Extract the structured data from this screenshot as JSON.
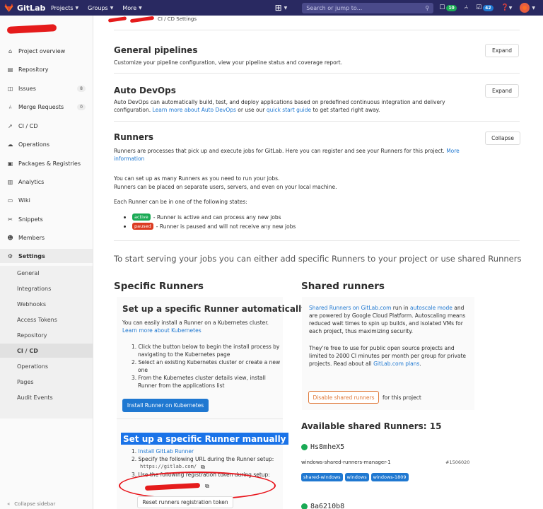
{
  "topbar": {
    "logo_text": "GitLab",
    "nav": [
      "Projects",
      "Groups",
      "More"
    ],
    "search_placeholder": "Search or jump to...",
    "todo_count": "10",
    "mr_count": "42"
  },
  "sidebar": {
    "items": [
      {
        "label": "Project overview",
        "icon": "home-icon"
      },
      {
        "label": "Repository",
        "icon": "book-icon"
      },
      {
        "label": "Issues",
        "icon": "issues-icon",
        "count": "8"
      },
      {
        "label": "Merge Requests",
        "icon": "merge-request-icon",
        "count": "0"
      },
      {
        "label": "CI / CD",
        "icon": "rocket-icon"
      },
      {
        "label": "Operations",
        "icon": "cloud-icon"
      },
      {
        "label": "Packages & Registries",
        "icon": "package-icon"
      },
      {
        "label": "Analytics",
        "icon": "chart-icon"
      },
      {
        "label": "Wiki",
        "icon": "book-open-icon"
      },
      {
        "label": "Snippets",
        "icon": "scissors-icon"
      },
      {
        "label": "Members",
        "icon": "users-icon"
      },
      {
        "label": "Settings",
        "icon": "gear-icon"
      }
    ],
    "sub_items": [
      "General",
      "Integrations",
      "Webhooks",
      "Access Tokens",
      "Repository",
      "CI / CD",
      "Operations",
      "Pages",
      "Audit Events"
    ],
    "collapse_label": "Collapse sidebar"
  },
  "breadcrumb": {
    "current": "CI / CD Settings"
  },
  "sections": {
    "pipelines": {
      "title": "General pipelines",
      "desc": "Customize your pipeline configuration, view your pipeline status and coverage report.",
      "button": "Expand"
    },
    "autodevops": {
      "title": "Auto DevOps",
      "desc_1": "Auto DevOps can automatically build, test, and deploy applications based on predefined continuous integration and delivery",
      "desc_2": "configuration. ",
      "link_1": "Learn more about Auto DevOps",
      "desc_3": " or use our ",
      "link_2": "quick start guide",
      "desc_4": " to get started right away.",
      "button": "Expand"
    },
    "runners": {
      "title": "Runners",
      "desc": "Runners are processes that pick up and execute jobs for GitLab. Here you can register and see your Runners for this project. ",
      "link_1": "More",
      "link_2": "information",
      "button": "Collapse"
    }
  },
  "runners_info": {
    "line_1": "You can set up as many Runners as you need to run your jobs.",
    "line_2": "Runners can be placed on separate users, servers, and even on your local machine.",
    "line_3": "Each Runner can be in one of the following states:",
    "active_label": "active",
    "active_text": "- Runner is active and can process any new jobs",
    "paused_label": "paused",
    "paused_text": "- Runner is paused and will not receive any new jobs",
    "lead": "To start serving your jobs you can either add specific Runners to your project or use shared Runners"
  },
  "specific": {
    "title": "Specific Runners",
    "auto_title": "Set up a specific Runner automatically",
    "auto_desc": "You can easily install a Runner on a Kubernetes cluster.",
    "auto_link": "Learn more about Kubernetes",
    "steps": [
      "1. Click the button below to begin the install process by",
      "navigating to the Kubernetes page",
      "2. Select an existing Kubernetes cluster or create a new",
      "one",
      "3. From the Kubernetes cluster details view, install",
      "Runner from the applications list"
    ],
    "install_button": "Install Runner on Kubernetes",
    "manual_title": "Set up a specific Runner manually",
    "manual_step_1_prefix": "1. ",
    "manual_step_1_link": "Install GitLab Runner",
    "manual_step_2": "2. Specify the following URL during the Runner setup:",
    "url": "https://gitlab.com/",
    "manual_step_3": "3. Use the following registration token during setup:",
    "reset_button": "Reset runners registration token"
  },
  "shared": {
    "title": "Shared runners",
    "p1_link_1": "Shared Runners on GitLab.com",
    "p1_a": " run in ",
    "p1_link_2": "autoscale mode",
    "p1_b": " and",
    "p1_lines": [
      "are powered by Google Cloud Platform. Autoscaling means",
      "reduced wait times to spin up builds, and isolated VMs for",
      "each project, thus maximizing security."
    ],
    "p2_lines": [
      "They're free to use for public open source projects and",
      "limited to 2000 CI minutes per month per group for private"
    ],
    "p2_last": "projects. Read about all ",
    "p2_link": "GitLab.com plans",
    "p2_end": ".",
    "disable_button": "Disable shared runners",
    "disable_suffix": "for this project",
    "available_title": "Available shared Runners: 15",
    "runner_1": {
      "name": "Hs8mheX5",
      "desc": "windows-shared-runners-manager-1",
      "id": "#1506020",
      "tags": [
        "shared-windows",
        "windows",
        "windows-1809"
      ]
    },
    "runner_2": {
      "name": "8a6210b8"
    }
  },
  "colors": {
    "nav_bg": "#292961",
    "accent": "#1f78d1",
    "success": "#1aaa55",
    "danger": "#db3b21",
    "warning": "#e07a3b"
  }
}
